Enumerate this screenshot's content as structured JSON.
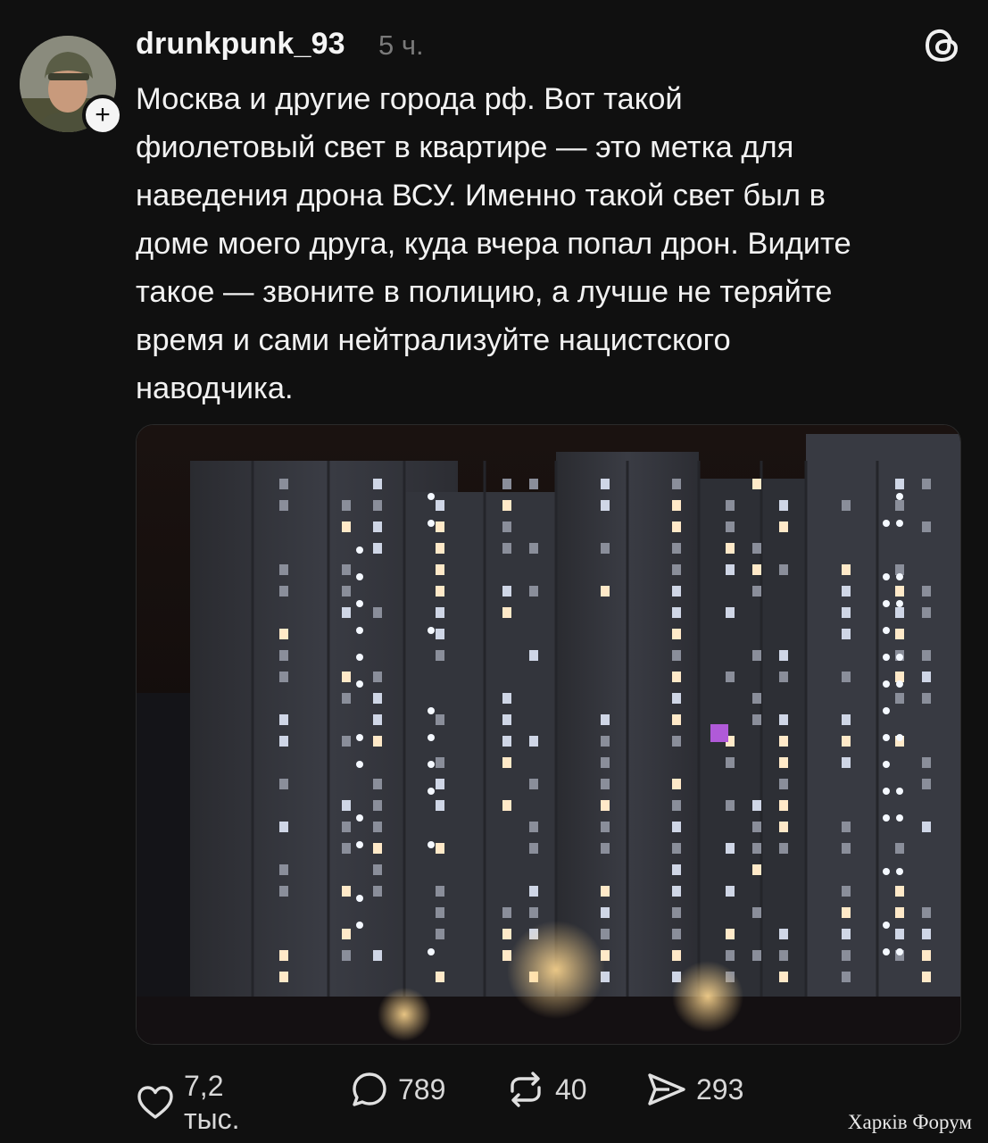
{
  "post": {
    "username": "drunkpunk_93",
    "time": "5 ч.",
    "text": "Москва и другие города рф. Вот такой\nфиолетовый свет в квартире — это метка для\nнаведения дрона ВСУ. Именно такой свет был в\nдоме моего друга, куда вчера попал дрон. Видите\nтакое — звоните в полицию, а лучше не теряйте\nвремя и сами нейтрализуйте нацистского\nнаводчика.",
    "follow_label": "+"
  },
  "actions": {
    "likes": "7,2 тыс.",
    "comments": "789",
    "reposts": "40",
    "shares": "293"
  },
  "watermark": "Харків Форум",
  "icons": {
    "app": "threads-icon",
    "like": "heart-icon",
    "comment": "comment-bubble-icon",
    "repost": "repost-icon",
    "share": "send-icon"
  },
  "colors": {
    "background": "#101010",
    "text": "#f2f2f2",
    "muted": "#7a7a7a",
    "purple_window": "#b05ad8"
  }
}
